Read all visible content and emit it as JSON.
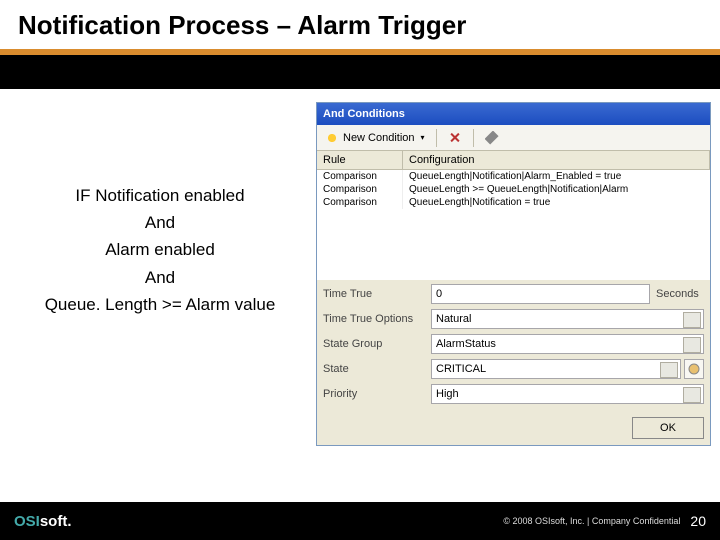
{
  "slide": {
    "title": "Notification Process – Alarm Trigger",
    "pseudo": [
      "IF Notification enabled",
      "And",
      "Alarm enabled",
      "And",
      "Queue. Length >= Alarm value"
    ]
  },
  "window": {
    "title": "And Conditions",
    "toolbar": {
      "newCondition": "New Condition"
    },
    "grid": {
      "headers": {
        "rule": "Rule",
        "config": "Configuration"
      },
      "rows": [
        {
          "rule": "Comparison",
          "config": "QueueLength|Notification|Alarm_Enabled = true"
        },
        {
          "rule": "Comparison",
          "config": "QueueLength >= QueueLength|Notification|Alarm"
        },
        {
          "rule": "Comparison",
          "config": "QueueLength|Notification = true"
        }
      ]
    },
    "form": {
      "timeTrue": {
        "label": "Time True",
        "value": "0",
        "unit": "Seconds"
      },
      "timeTrueOptions": {
        "label": "Time True Options",
        "value": "Natural"
      },
      "stateGroup": {
        "label": "State Group",
        "value": "AlarmStatus"
      },
      "state": {
        "label": "State",
        "value": "CRITICAL"
      },
      "priority": {
        "label": "Priority",
        "value": "High"
      }
    },
    "ok": "OK"
  },
  "footer": {
    "logo": "OSIsoft.",
    "copyright": "© 2008 OSIsoft, Inc.  |  Company Confidential",
    "page": "20"
  }
}
